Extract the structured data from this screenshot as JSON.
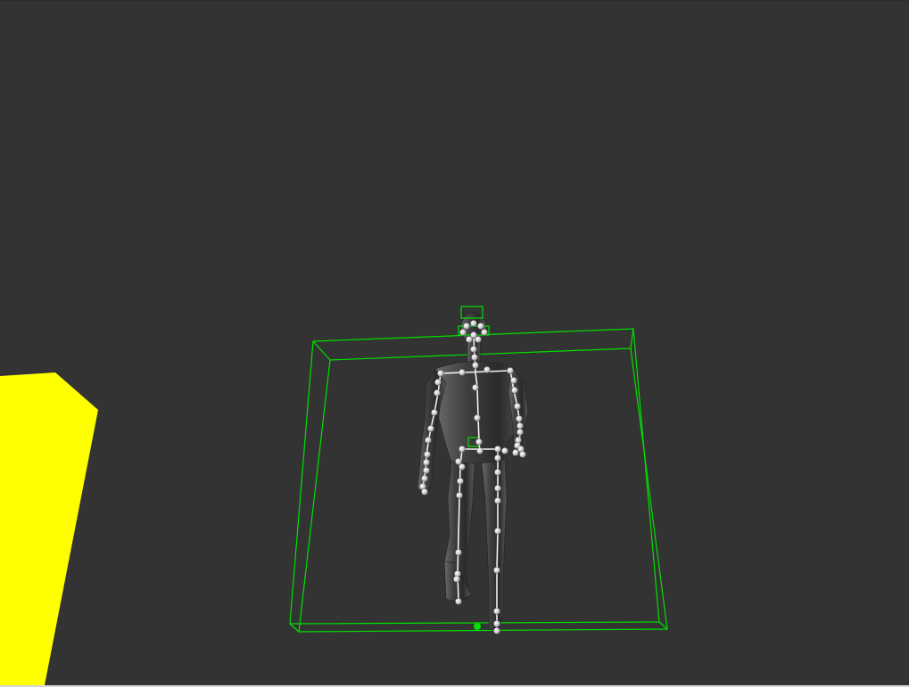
{
  "viewport": {
    "background": "#333333",
    "selection_color": "#00e000",
    "object_color": "#ffff00",
    "figure_color": "#4a4a4a",
    "joint_color": "#d8d8d8",
    "bone_color": "#f2f2f2"
  }
}
